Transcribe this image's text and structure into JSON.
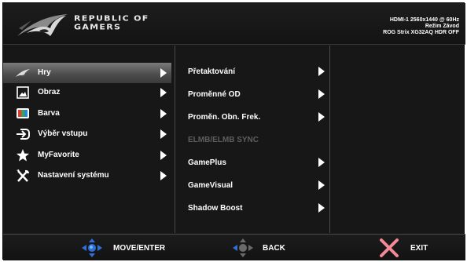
{
  "header": {
    "brand_line1": "REPUBLIC OF",
    "brand_line2": "GAMERS",
    "status_line1": "HDMI-1 2560x1440 @ 60Hz",
    "status_line2": "Režim Závod",
    "status_line3": "ROG Strix XG32AQ HDR OFF"
  },
  "main_menu": [
    {
      "label": "Hry",
      "icon": "rog-eye-icon",
      "selected": true
    },
    {
      "label": "Obraz",
      "icon": "image-icon",
      "selected": false
    },
    {
      "label": "Barva",
      "icon": "color-icon",
      "selected": false
    },
    {
      "label": "Výběr vstupu",
      "icon": "input-icon",
      "selected": false
    },
    {
      "label": "MyFavorite",
      "icon": "star-icon",
      "selected": false
    },
    {
      "label": "Nastavení systému",
      "icon": "tools-icon",
      "selected": false
    }
  ],
  "sub_menu": [
    {
      "label": "Přetaktování",
      "enabled": true
    },
    {
      "label": "Proměnné OD",
      "enabled": true
    },
    {
      "label": "Proměn. Obn. Frek.",
      "enabled": true
    },
    {
      "label": "ELMB/ELMB SYNC",
      "enabled": false
    },
    {
      "label": "GamePlus",
      "enabled": true
    },
    {
      "label": "GameVisual",
      "enabled": true
    },
    {
      "label": "Shadow Boost",
      "enabled": true
    }
  ],
  "footer": {
    "move_label": "MOVE/ENTER",
    "back_label": "BACK",
    "exit_label": "EXIT"
  },
  "colors": {
    "accent_blue": "#2f6fd8",
    "exit_red": "#f28a96",
    "disabled_text": "#5e5e5e"
  }
}
